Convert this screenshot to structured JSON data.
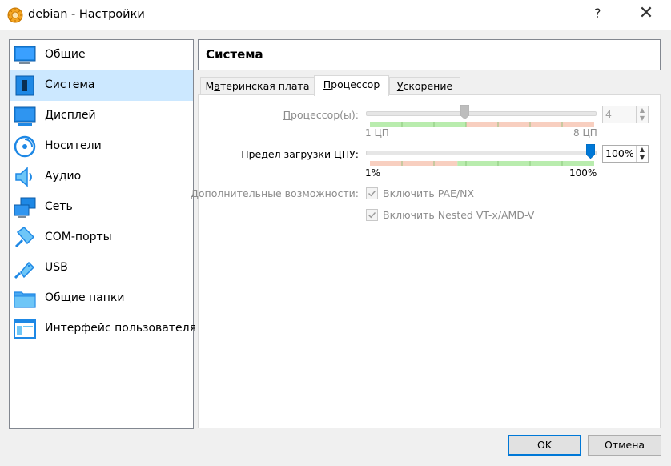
{
  "window": {
    "title": "debian - Настройки",
    "help_label": "?",
    "close_label": "✕"
  },
  "sidebar": {
    "items": [
      {
        "label": "Общие",
        "icon": "monitor-icon",
        "selected": false
      },
      {
        "label": "Система",
        "icon": "motherboard-icon",
        "selected": true
      },
      {
        "label": "Дисплей",
        "icon": "display-icon",
        "selected": false
      },
      {
        "label": "Носители",
        "icon": "disk-icon",
        "selected": false
      },
      {
        "label": "Аудио",
        "icon": "speaker-icon",
        "selected": false
      },
      {
        "label": "Сеть",
        "icon": "network-icon",
        "selected": false
      },
      {
        "label": "COM-порты",
        "icon": "serial-port-icon",
        "selected": false
      },
      {
        "label": "USB",
        "icon": "usb-icon",
        "selected": false
      },
      {
        "label": "Общие папки",
        "icon": "folder-icon",
        "selected": false
      },
      {
        "label": "Интерфейс пользователя",
        "icon": "ui-window-icon",
        "selected": false
      }
    ]
  },
  "header": {
    "title": "Система"
  },
  "tabs": {
    "motherboard": {
      "pre": "М",
      "ul": "а",
      "post": "теринская плата"
    },
    "processor": {
      "pre": "",
      "ul": "П",
      "post": "роцессор"
    },
    "acceleration": {
      "pre": "",
      "ul": "У",
      "post": "скорение"
    }
  },
  "processor": {
    "cpu_count": {
      "label_pre": "",
      "label_ul": "П",
      "label_post": "роцессор(ы):",
      "value": "4",
      "min_label": "1 ЦП",
      "max_label": "8 ЦП",
      "min": 1,
      "max": 8,
      "current": 4,
      "enabled": false
    },
    "cpu_limit": {
      "label_pre": "Предел ",
      "label_ul": "з",
      "label_post": "агрузки ЦПУ:",
      "value": "100%",
      "min_label": "1%",
      "max_label": "100%",
      "min": 1,
      "max": 100,
      "current": 100,
      "enabled": true
    },
    "extended": {
      "label": "Дополнительные возможности:",
      "pae_label": "Включить PAE/NX",
      "pae_checked": true,
      "nested_label": "Включить Nested VT-x/AMD-V",
      "nested_checked": true
    }
  },
  "buttons": {
    "ok": "OK",
    "cancel": "Отмена"
  },
  "colors": {
    "selection": "#cce8ff",
    "accent": "#0078d7",
    "scale_green": "#b9ecae",
    "scale_red": "#f8cfc0"
  }
}
